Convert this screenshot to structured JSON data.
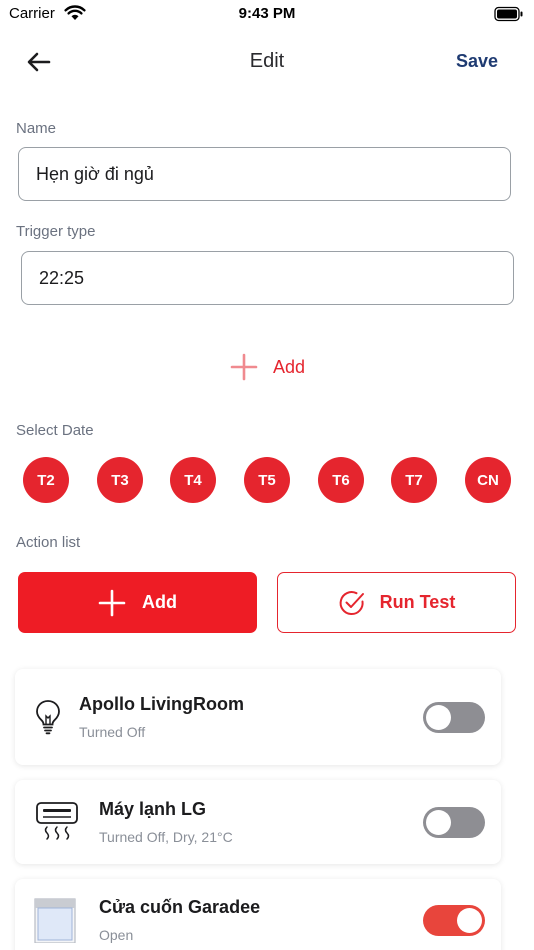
{
  "status_bar": {
    "carrier": "Carrier",
    "time": "9:43 PM"
  },
  "nav": {
    "title": "Edit",
    "save_label": "Save"
  },
  "name_field": {
    "label": "Name",
    "value": "Hẹn giờ đi ngủ"
  },
  "trigger_field": {
    "label": "Trigger type",
    "value": "22:25"
  },
  "add_trigger_label": "Add",
  "select_date": {
    "label": "Select Date",
    "days": [
      "T2",
      "T3",
      "T4",
      "T5",
      "T6",
      "T7",
      "CN"
    ]
  },
  "action_list": {
    "label": "Action list",
    "add_label": "Add",
    "run_test_label": "Run Test"
  },
  "devices": [
    {
      "name": "Apollo LivingRoom",
      "status": "Turned Off",
      "icon": "light-bulb-icon",
      "on": false
    },
    {
      "name": "Máy lạnh LG",
      "status": "Turned Off, Dry, 21°C",
      "icon": "air-conditioner-icon",
      "on": false
    },
    {
      "name": "Cửa cuốn Garadee",
      "status": "Open",
      "icon": "roller-shutter-icon",
      "on": true
    }
  ],
  "colors": {
    "accent": "#e5252e",
    "primary_button": "#ee1c25",
    "save": "#1f3b72",
    "toggle_off": "#8e8e93"
  }
}
